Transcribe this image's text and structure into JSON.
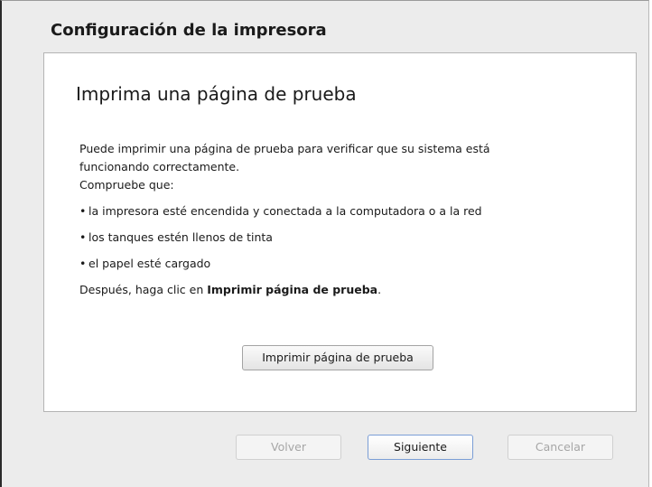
{
  "window": {
    "title": "Configuración de la impresora"
  },
  "panel": {
    "heading": "Imprima una página de prueba",
    "intro_line1": "Puede imprimir una página de prueba para verificar que su sistema está",
    "intro_line2": "funcionando correctamente.",
    "check_label": "Compruebe que:",
    "bullet_glyph": "•",
    "bullets": [
      "la impresora esté encendida y conectada a la computadora o a la red",
      "los tanques estén llenos de tinta",
      "el papel esté cargado"
    ],
    "instruction_prefix": "Después, haga clic en ",
    "instruction_bold": "Imprimir página de prueba",
    "instruction_suffix": ".",
    "print_test_button": "Imprimir página de prueba"
  },
  "footer": {
    "back_button": "Volver",
    "next_button": "Siguiente",
    "cancel_button": "Cancelar"
  },
  "colors": {
    "window_bg": "#ececec",
    "panel_bg": "#ffffff",
    "default_button_border": "#7b9ed6",
    "disabled_text": "#a6a6a6"
  }
}
